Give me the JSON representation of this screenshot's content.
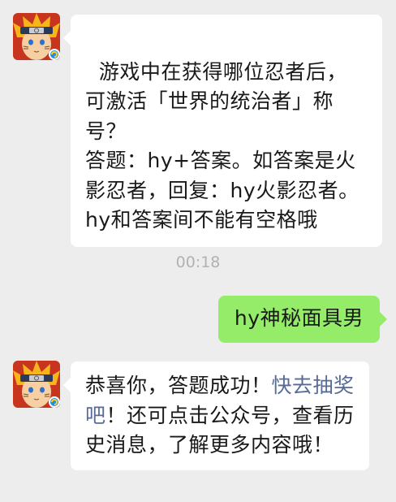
{
  "messages": [
    {
      "type": "incoming",
      "avatar_icon": "naruto-avatar-icon",
      "text": "游戏中在获得哪位忍者后，可激活「世界的统治者」称号？\n答题：hy+答案。如答案是火影忍者，回复：hy火影忍者。hy和答案间不能有空格哦"
    },
    {
      "type": "timestamp",
      "text": "00:18"
    },
    {
      "type": "outgoing",
      "text": "hy神秘面具男"
    },
    {
      "type": "incoming",
      "avatar_icon": "naruto-avatar-icon",
      "text_before_link": "恭喜你，答题成功！",
      "link_text": "快去抽奖吧",
      "text_after_link": "！还可点击公众号，查看历史消息，了解更多内容哦！"
    }
  ],
  "colors": {
    "background": "#ededed",
    "incoming_bubble": "#ffffff",
    "outgoing_bubble": "#95ec69",
    "link": "#576b95",
    "timestamp": "#b2b2b2"
  }
}
